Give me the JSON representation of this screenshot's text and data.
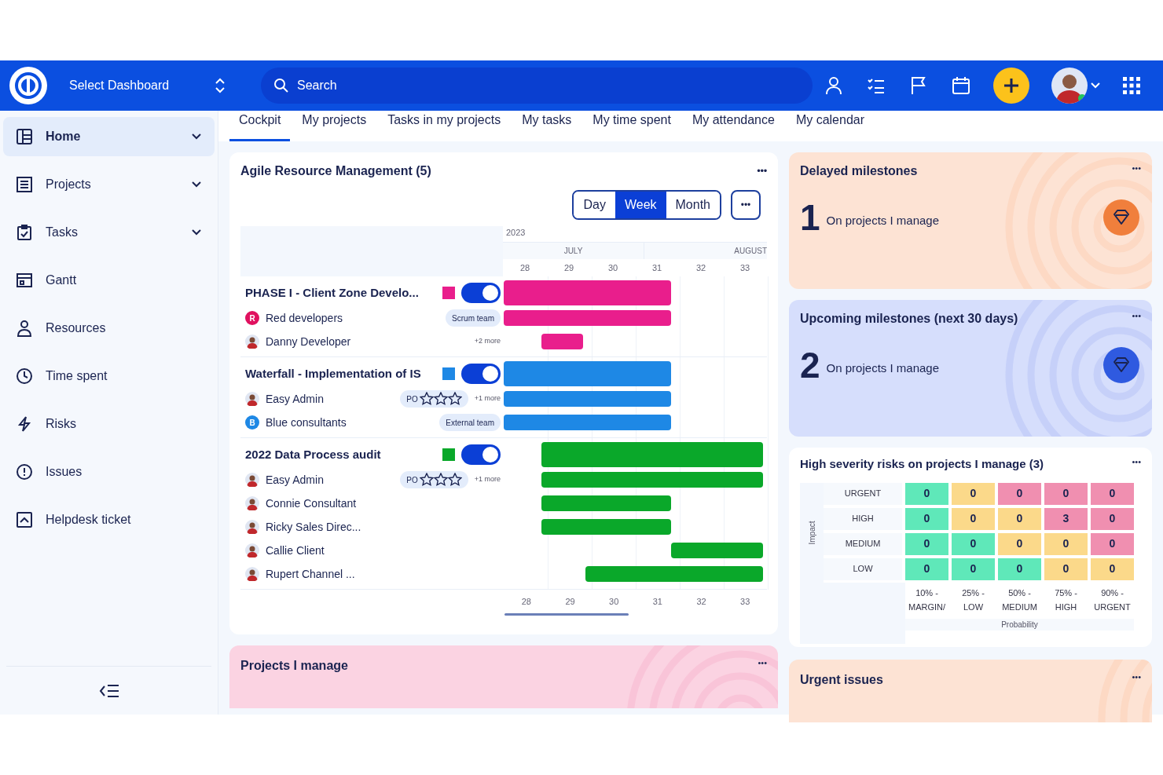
{
  "topbar": {
    "dashboard_select": "Select Dashboard",
    "search": {
      "placeholder": "Search"
    }
  },
  "sidebar": {
    "items": [
      {
        "label": "Home",
        "selected": true,
        "expandable": true
      },
      {
        "label": "Projects",
        "selected": false,
        "expandable": true
      },
      {
        "label": "Tasks",
        "selected": false,
        "expandable": true
      },
      {
        "label": "Gantt",
        "selected": false,
        "expandable": false
      },
      {
        "label": "Resources",
        "selected": false,
        "expandable": false
      },
      {
        "label": "Time spent",
        "selected": false,
        "expandable": false
      },
      {
        "label": "Risks",
        "selected": false,
        "expandable": false
      },
      {
        "label": "Issues",
        "selected": false,
        "expandable": false
      },
      {
        "label": "Helpdesk ticket",
        "selected": false,
        "expandable": false
      }
    ]
  },
  "tabs": [
    {
      "label": "Cockpit",
      "selected": true
    },
    {
      "label": "My projects",
      "selected": false
    },
    {
      "label": "Tasks in my projects",
      "selected": false
    },
    {
      "label": "My tasks",
      "selected": false
    },
    {
      "label": "My time spent",
      "selected": false
    },
    {
      "label": "My attendance",
      "selected": false
    },
    {
      "label": "My calendar",
      "selected": false
    }
  ],
  "resource_card": {
    "title": "Agile Resource Management (5)",
    "menu": "•••",
    "views": [
      {
        "label": "Day",
        "selected": false
      },
      {
        "label": "Week",
        "selected": true
      },
      {
        "label": "Month",
        "selected": false
      }
    ],
    "more": "•••",
    "year": "2023",
    "months": [
      "JULY",
      "AUGUST"
    ],
    "weeks": [
      "28",
      "29",
      "30",
      "31",
      "32",
      "33"
    ],
    "footer_weeks": [
      "28",
      "29",
      "30",
      "31",
      "32",
      "33"
    ],
    "projects": [
      {
        "name": "PHASE I - Client Zone Develo...",
        "color": "#e91e8c",
        "on": true,
        "resources": [
          {
            "name": "Red developers",
            "avatar": "R",
            "tag": "Scrum team"
          },
          {
            "name": "Danny Developer",
            "more": "+2 more"
          }
        ]
      },
      {
        "name": "Waterfall - Implementation of IS",
        "color": "#1e88e5",
        "on": true,
        "resources": [
          {
            "name": "Easy Admin",
            "tag": "PO",
            "stars": 0,
            "more": "+1 more"
          },
          {
            "name": "Blue consultants",
            "avatar": "B",
            "tag": "External team"
          }
        ]
      },
      {
        "name": "2022 Data Process audit",
        "color": "#0aa82a",
        "on": true,
        "resources": [
          {
            "name": "Easy Admin",
            "tag": "PO",
            "stars": 0,
            "more": "+1 more"
          },
          {
            "name": "Connie Consultant"
          },
          {
            "name": "Ricky Sales Direc..."
          },
          {
            "name": "Callie Client"
          },
          {
            "name": "Rupert Channel ..."
          }
        ]
      }
    ]
  },
  "milestones": [
    {
      "title": "Delayed milestones",
      "menu": "•••",
      "count": "1",
      "caption": "On projects I manage",
      "kind": "orange"
    },
    {
      "title": "Upcoming milestones (next 30 days)",
      "menu": "•••",
      "count": "2",
      "caption": "On projects I manage",
      "kind": "blue"
    }
  ],
  "risks": {
    "title": "High severity risks on projects I manage (3)",
    "menu": "•••",
    "rows": [
      {
        "label": "URGENT",
        "cells": [
          {
            "value": "0",
            "color": "#5fe8b9"
          },
          {
            "value": "0",
            "color": "#fbd98a"
          },
          {
            "value": "0",
            "color": "#f08fb0"
          },
          {
            "value": "0",
            "color": "#f08fb0"
          },
          {
            "value": "0",
            "color": "#f08fb0"
          }
        ]
      },
      {
        "label": "HIGH",
        "cells": [
          {
            "value": "0",
            "color": "#5fe8b9"
          },
          {
            "value": "0",
            "color": "#fbd98a"
          },
          {
            "value": "0",
            "color": "#fbd98a"
          },
          {
            "value": "3",
            "color": "#f08fb0"
          },
          {
            "value": "0",
            "color": "#f08fb0"
          }
        ]
      },
      {
        "label": "MEDIUM",
        "cells": [
          {
            "value": "0",
            "color": "#5fe8b9"
          },
          {
            "value": "0",
            "color": "#5fe8b9"
          },
          {
            "value": "0",
            "color": "#fbd98a"
          },
          {
            "value": "0",
            "color": "#fbd98a"
          },
          {
            "value": "0",
            "color": "#f08fb0"
          }
        ]
      },
      {
        "label": "LOW",
        "cells": [
          {
            "value": "0",
            "color": "#5fe8b9"
          },
          {
            "value": "0",
            "color": "#5fe8b9"
          },
          {
            "value": "0",
            "color": "#5fe8b9"
          },
          {
            "value": "0",
            "color": "#fbd98a"
          },
          {
            "value": "0",
            "color": "#fbd98a"
          }
        ]
      }
    ],
    "y_axis": "Impact",
    "probability_labels": [
      "10% - MARGIN/",
      "25% - LOW",
      "50% - MEDIUM",
      "75% - HIGH",
      "90% - URGENT"
    ],
    "x_axis": "Probability"
  },
  "bottom_cards": [
    {
      "title": "Projects I manage",
      "menu": "•••",
      "kind": "pink"
    },
    {
      "title": "Urgent issues",
      "menu": "•••",
      "kind": "orange"
    }
  ]
}
